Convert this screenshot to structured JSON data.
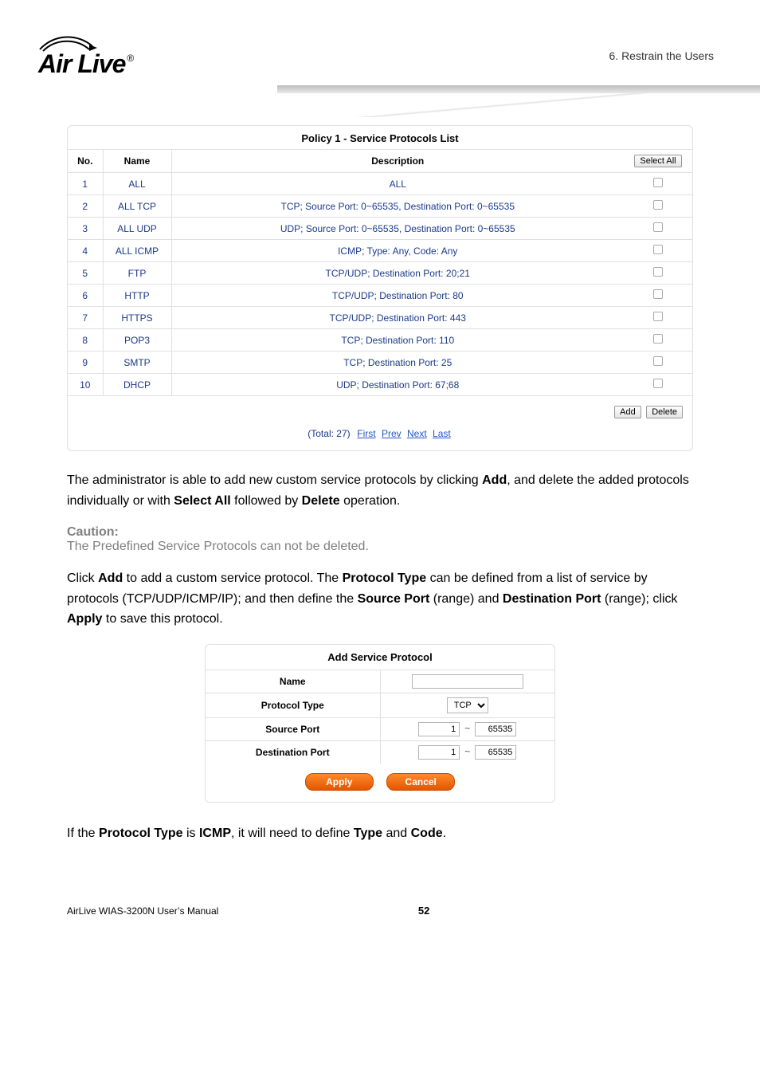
{
  "header": {
    "breadcrumb": "6. Restrain the Users",
    "logo_main": "Air Live",
    "logo_reg": "®"
  },
  "protocols_table": {
    "title": "Policy 1 - Service Protocols List",
    "col_no": "No.",
    "col_name": "Name",
    "col_desc": "Description",
    "select_all": "Select All",
    "rows": [
      {
        "no": "1",
        "name": "ALL",
        "desc": "ALL"
      },
      {
        "no": "2",
        "name": "ALL TCP",
        "desc": "TCP; Source Port: 0~65535, Destination Port: 0~65535"
      },
      {
        "no": "3",
        "name": "ALL UDP",
        "desc": "UDP; Source Port: 0~65535, Destination Port: 0~65535"
      },
      {
        "no": "4",
        "name": "ALL ICMP",
        "desc": "ICMP; Type: Any, Code: Any"
      },
      {
        "no": "5",
        "name": "FTP",
        "desc": "TCP/UDP; Destination Port: 20;21"
      },
      {
        "no": "6",
        "name": "HTTP",
        "desc": "TCP/UDP; Destination Port: 80"
      },
      {
        "no": "7",
        "name": "HTTPS",
        "desc": "TCP/UDP; Destination Port: 443"
      },
      {
        "no": "8",
        "name": "POP3",
        "desc": "TCP; Destination Port: 110"
      },
      {
        "no": "9",
        "name": "SMTP",
        "desc": "TCP; Destination Port: 25"
      },
      {
        "no": "10",
        "name": "DHCP",
        "desc": "UDP; Destination Port: 67;68"
      }
    ],
    "add_btn": "Add",
    "delete_btn": "Delete",
    "pager_total": "(Total: 27)",
    "pager_first": "First",
    "pager_prev": "Prev",
    "pager_next": "Next",
    "pager_last": "Last"
  },
  "text": {
    "para1_a": "The administrator is able to add new custom service protocols by clicking ",
    "para1_b": "Add",
    "para1_c": ", and delete the added protocols individually or with ",
    "para1_d": "Select All",
    "para1_e": " followed by ",
    "para1_f": "Delete",
    "para1_g": " operation.",
    "caution_head": "Caution:",
    "caution_body": "The Predefined Service Protocols can not be deleted.",
    "para2_a": "Click ",
    "para2_b": "Add",
    "para2_c": " to add a custom service protocol. The ",
    "para2_d": "Protocol Type",
    "para2_e": " can be defined from a list of service by protocols (TCP/UDP/ICMP/IP); and then define the ",
    "para2_f": "Source Port",
    "para2_g": " (range) and ",
    "para2_h": "Destination Port",
    "para2_i": " (range); click ",
    "para2_j": "Apply",
    "para2_k": " to save this protocol.",
    "para3_a": "If the ",
    "para3_b": "Protocol Type",
    "para3_c": " is ",
    "para3_d": "ICMP",
    "para3_e": ", it will need to define ",
    "para3_f": "Type",
    "para3_g": " and ",
    "para3_h": "Code",
    "para3_i": "."
  },
  "add_panel": {
    "title": "Add Service Protocol",
    "name_label": "Name",
    "name_value": "",
    "ptype_label": "Protocol Type",
    "ptype_value": "TCP",
    "sport_label": "Source Port",
    "sport_from": "1",
    "sport_to": "65535",
    "dport_label": "Destination Port",
    "dport_from": "1",
    "dport_to": "65535",
    "range_sep": "~",
    "apply": "Apply",
    "cancel": "Cancel"
  },
  "footer": {
    "manual": "AirLive WIAS-3200N User’s Manual",
    "page": "52"
  }
}
